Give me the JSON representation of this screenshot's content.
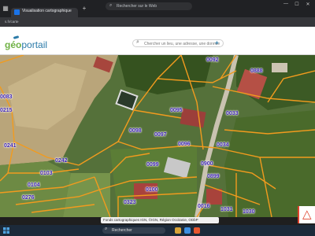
{
  "browser": {
    "tab_title": "Visualisation cartographique",
    "address_placeholder": "Rechercher sur le Web",
    "url_text": "s.fr/carte",
    "icons": [
      "grid-icon",
      "plus-icon",
      "search-icon",
      "minimize-icon",
      "maximize-icon",
      "close-icon"
    ]
  },
  "header": {
    "logo_geo": "géo",
    "logo_portail": "portail",
    "search_placeholder": "Chercher un lieu, une adresse, une donnée",
    "add_label": "+"
  },
  "map": {
    "parcels": [
      "0092",
      "0888",
      "0033",
      "0095",
      "0098",
      "0097",
      "0096",
      "0034",
      "0083",
      "0215",
      "0241",
      "0242",
      "0103",
      "0104",
      "0276",
      "0099",
      "0900",
      "0899",
      "0100",
      "0323",
      "0016",
      "1031",
      "1030"
    ],
    "colors": {
      "boundary": "#f29b1e",
      "label": "#3a1fb0"
    }
  },
  "attribution": {
    "text": "Fonds cartographiques   IGN, ©IGN, Région Occitanie, ODbP"
  },
  "taskbar": {
    "search_label": "Rechercher"
  }
}
